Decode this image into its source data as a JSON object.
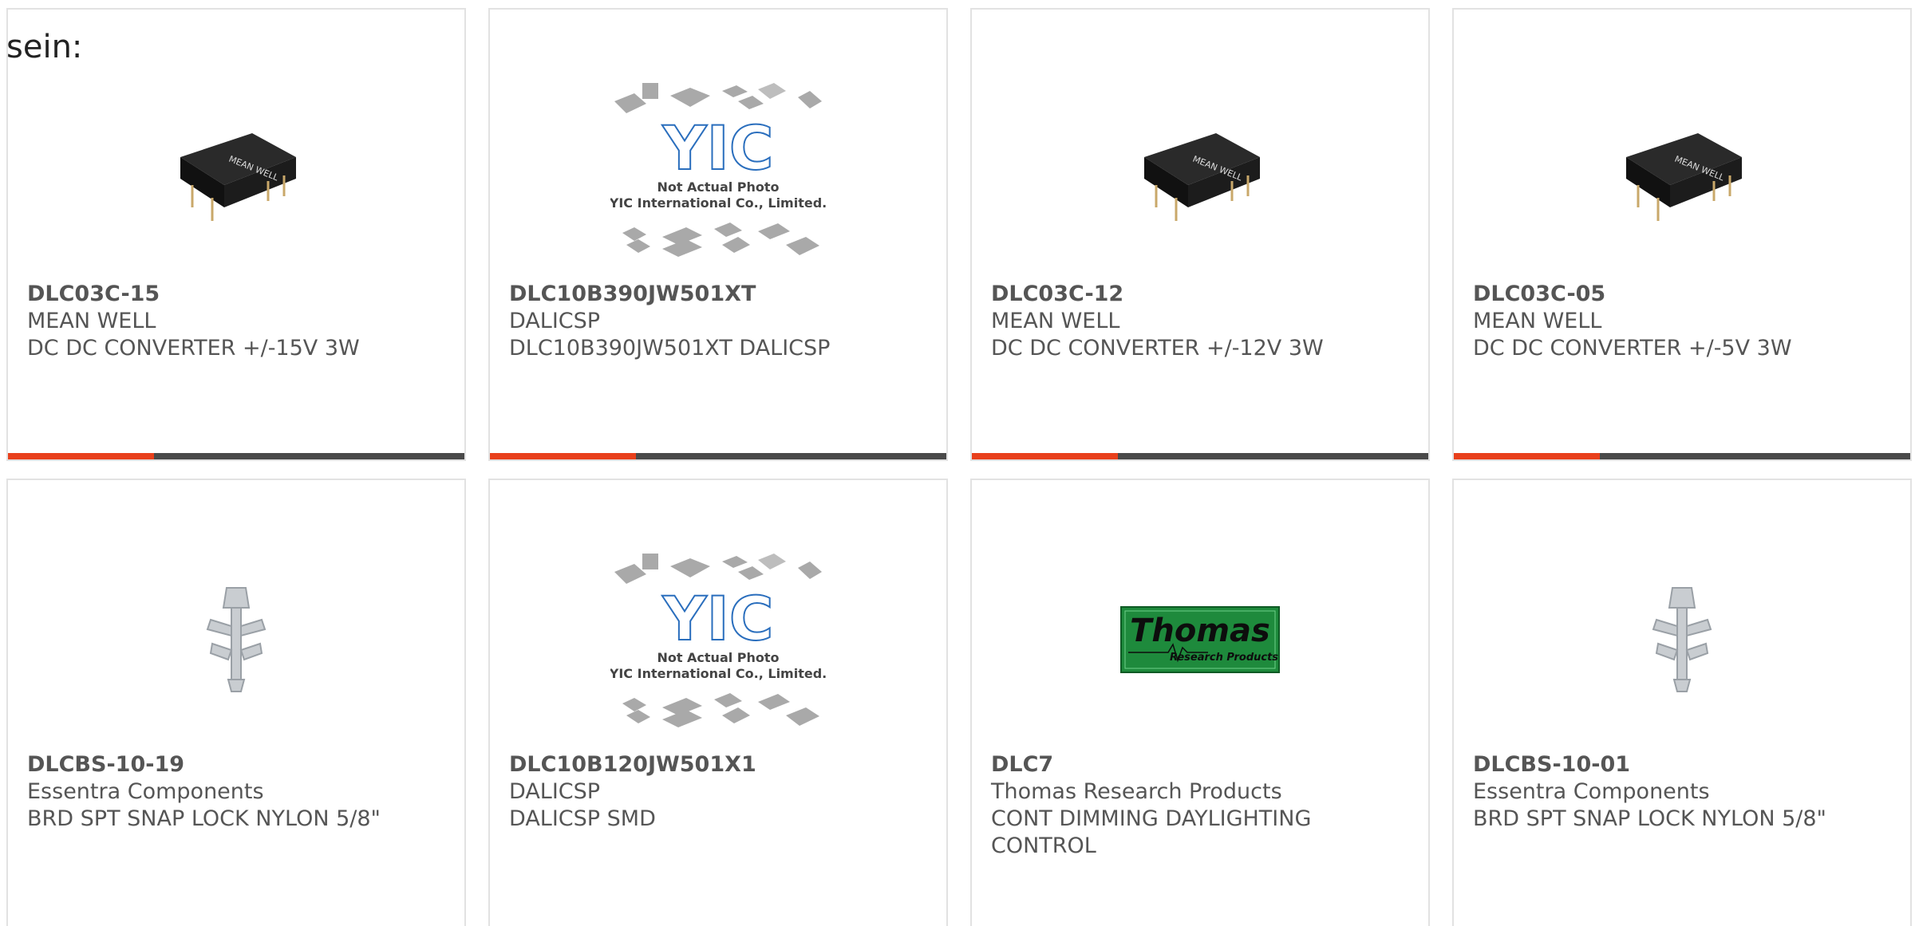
{
  "fragment_text": "sein:",
  "colors": {
    "accent": "#e8401c",
    "bar": "#4a4a4a",
    "border": "#e2e2e2",
    "text": "#555555"
  },
  "products": [
    {
      "part": "DLC03C-15",
      "manufacturer": "MEAN WELL",
      "description": "DC DC CONVERTER +/-15V 3W",
      "image": "dc-converter-module"
    },
    {
      "part": "DLC10B390JW501XT",
      "manufacturer": "DALICSP",
      "description": "DLC10B390JW501XT DALICSP",
      "image": "placeholder-photo"
    },
    {
      "part": "DLC03C-12",
      "manufacturer": "MEAN WELL",
      "description": "DC DC CONVERTER +/-12V 3W",
      "image": "dc-converter-module"
    },
    {
      "part": "DLC03C-05",
      "manufacturer": "MEAN WELL",
      "description": "DC DC CONVERTER +/-5V 3W",
      "image": "dc-converter-module"
    },
    {
      "part": "DLCBS-10-19",
      "manufacturer": "Essentra Components",
      "description": "BRD SPT SNAP LOCK NYLON 5/8\"",
      "image": "snap-lock"
    },
    {
      "part": "DLC10B120JW501X1",
      "manufacturer": "DALICSP",
      "description": "DALICSP SMD",
      "image": "placeholder-photo"
    },
    {
      "part": "DLC7",
      "manufacturer": "Thomas Research Products",
      "description": "CONT DIMMING DAYLIGHTING CONTROL",
      "image": "thomas-logo"
    },
    {
      "part": "DLCBS-10-01",
      "manufacturer": "Essentra Components",
      "description": "BRD SPT SNAP LOCK NYLON 5/8\"",
      "image": "snap-lock"
    }
  ],
  "placeholder": {
    "line1": "Not Actual Photo",
    "line2": "YIC International Co., Limited.",
    "brand": "YIC"
  },
  "converter_label": "MEAN WELL",
  "thomas": {
    "word": "Thomas",
    "tagline": "Research Products"
  }
}
